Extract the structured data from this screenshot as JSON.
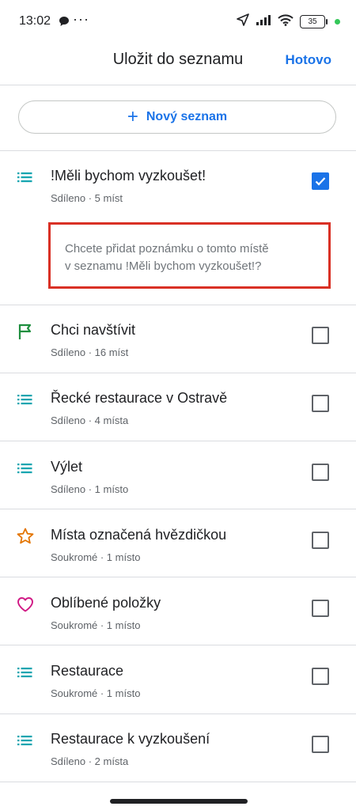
{
  "status_bar": {
    "time": "13:02",
    "dots": "···",
    "battery": "35"
  },
  "header": {
    "title": "Uložit do seznamu",
    "done_label": "Hotovo"
  },
  "new_list": {
    "label": "Nový seznam",
    "icon": "plus-icon"
  },
  "colors": {
    "accent": "#1a73e8",
    "note_border": "#d93025",
    "teal_icon": "#12a4af",
    "flag_icon": "#1e8e3e",
    "star_icon": "#e37400",
    "heart_icon": "#d01884"
  },
  "lists": [
    {
      "name": "!Měli bychom vyzkoušet!",
      "subtitle": "Sdíleno · 5 míst",
      "icon": "list-icon",
      "checked": true
    },
    {
      "name": "Chci navštívit",
      "subtitle": "Sdíleno · 16 míst",
      "icon": "flag-icon",
      "checked": false
    },
    {
      "name": "Řecké restaurace v Ostravě",
      "subtitle": "Sdíleno · 4 místa",
      "icon": "list-icon",
      "checked": false
    },
    {
      "name": "Výlet",
      "subtitle": "Sdíleno · 1 místo",
      "icon": "list-icon",
      "checked": false
    },
    {
      "name": "Místa označená hvězdičkou",
      "subtitle": "Soukromé · 1 místo",
      "icon": "star-icon",
      "checked": false
    },
    {
      "name": "Oblíbené položky",
      "subtitle": "Soukromé · 1 místo",
      "icon": "heart-icon",
      "checked": false
    },
    {
      "name": "Restaurace",
      "subtitle": "Soukromé · 1 místo",
      "icon": "list-icon",
      "checked": false
    },
    {
      "name": "Restaurace k vyzkoušení",
      "subtitle": "Sdíleno · 2 místa",
      "icon": "list-icon",
      "checked": false
    }
  ],
  "note": {
    "placeholder_line1": "Chcete přidat poznámku o tomto místě",
    "placeholder_line2": "v seznamu !Měli bychom vyzkoušet!?"
  }
}
